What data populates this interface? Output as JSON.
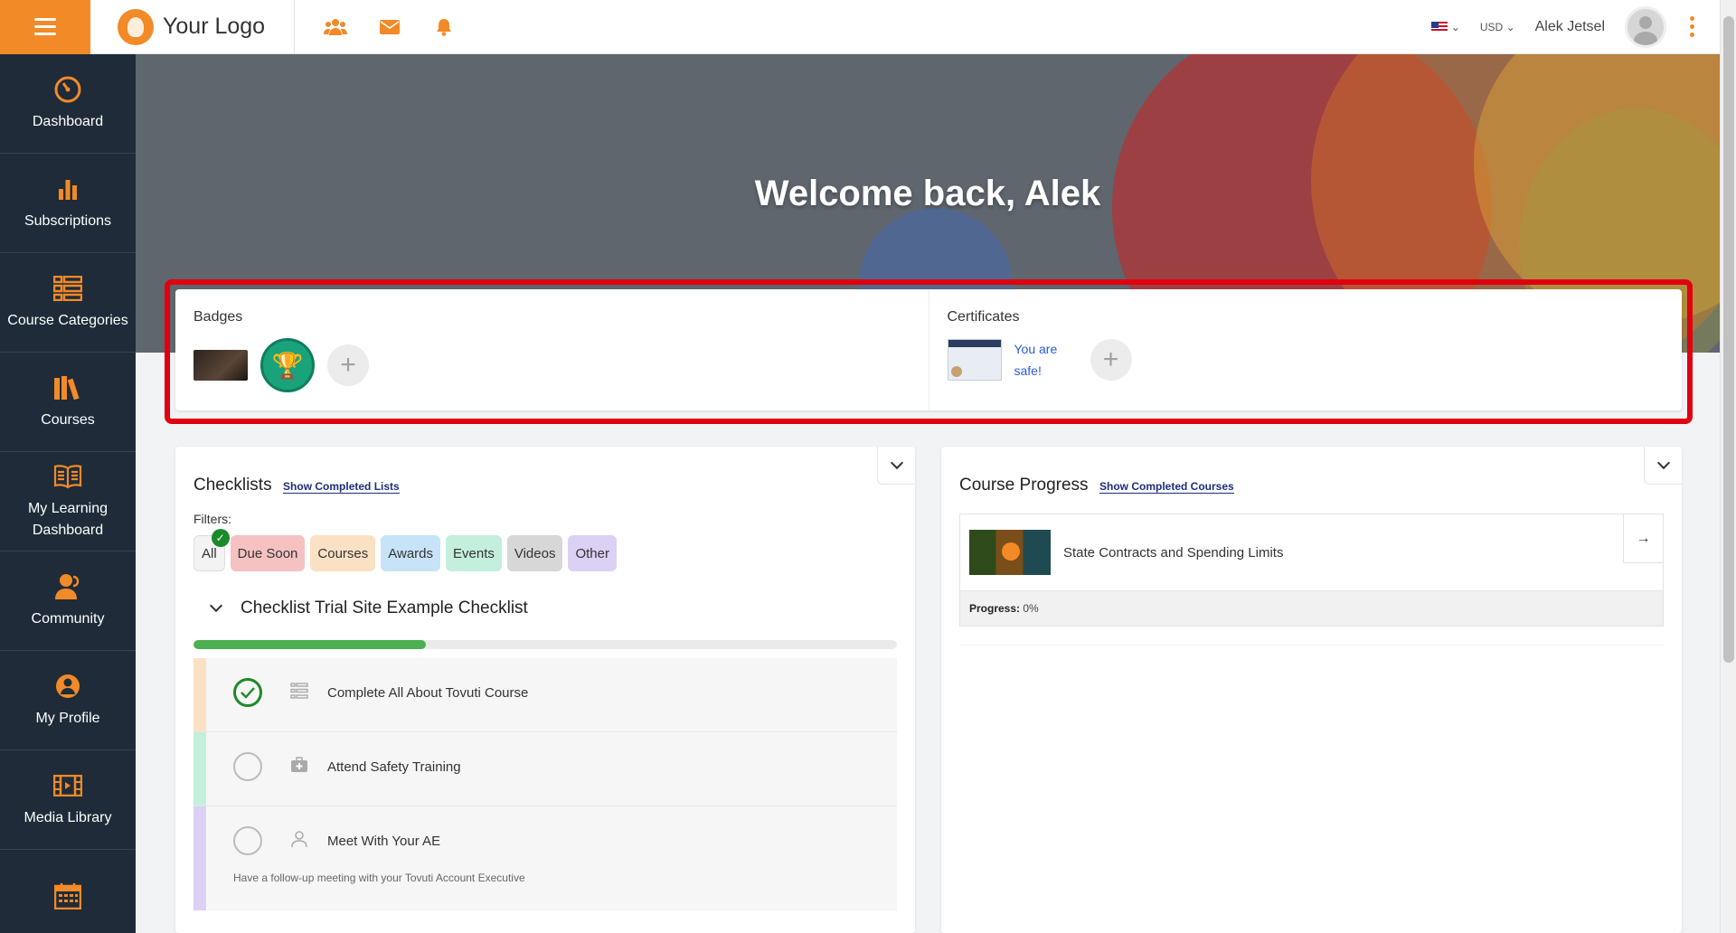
{
  "app": {
    "logo_text": "Your Logo",
    "top_icons": [
      "users-icon",
      "envelope-icon",
      "bell-icon"
    ],
    "currency": "USD",
    "user_name": "Alek Jetsel",
    "accent": "#f18a27"
  },
  "sidebar": {
    "items": [
      {
        "label": "Dashboard",
        "icon": "gauge-icon"
      },
      {
        "label": "Subscriptions",
        "icon": "bar-chart-icon"
      },
      {
        "label": "Course Categories",
        "icon": "list-icon"
      },
      {
        "label": "Courses",
        "icon": "books-icon"
      },
      {
        "label": "My Learning Dashboard",
        "icon": "open-book-icon"
      },
      {
        "label": "Community",
        "icon": "community-icon"
      },
      {
        "label": "My Profile",
        "icon": "user-circle-icon"
      },
      {
        "label": "Media Library",
        "icon": "film-icon"
      },
      {
        "label": "",
        "icon": "calendar-icon"
      }
    ]
  },
  "hero": {
    "title": "Welcome back, Alek"
  },
  "awards": {
    "badges_title": "Badges",
    "certificates_title": "Certificates",
    "broken_certificate_alt": "You are safe!"
  },
  "checklists": {
    "title": "Checklists",
    "show_completed": "Show Completed Lists",
    "filters_label": "Filters:",
    "filters": [
      {
        "label": "All",
        "bg": "#f3f3f3",
        "active": true
      },
      {
        "label": "Due Soon",
        "bg": "#f5c1c1"
      },
      {
        "label": "Courses",
        "bg": "#fbe1c4"
      },
      {
        "label": "Awards",
        "bg": "#c7e3f7"
      },
      {
        "label": "Events",
        "bg": "#c3efdc"
      },
      {
        "label": "Videos",
        "bg": "#d7d7d7"
      },
      {
        "label": "Other",
        "bg": "#dcd0f5"
      }
    ],
    "checklist_name": "Checklist Trial Site Example Checklist",
    "progress": 0.33,
    "tasks": [
      {
        "text": "Complete All About Tovuti Course",
        "color": "#fbe1c4",
        "done": true,
        "icon": "list-icon"
      },
      {
        "text": "Attend Safety Training",
        "color": "#c3efdc",
        "done": false,
        "icon": "first-aid-icon"
      },
      {
        "text": "Meet With Your AE",
        "color": "#dcd0f5",
        "done": false,
        "icon": "person-icon",
        "note": "Have a follow-up meeting with your Tovuti Account Executive"
      }
    ]
  },
  "course_progress": {
    "title": "Course Progress",
    "show_completed": "Show Completed Courses",
    "course_name": "State Contracts and Spending Limits",
    "progress_label": "Progress:",
    "progress_value": "0%"
  }
}
